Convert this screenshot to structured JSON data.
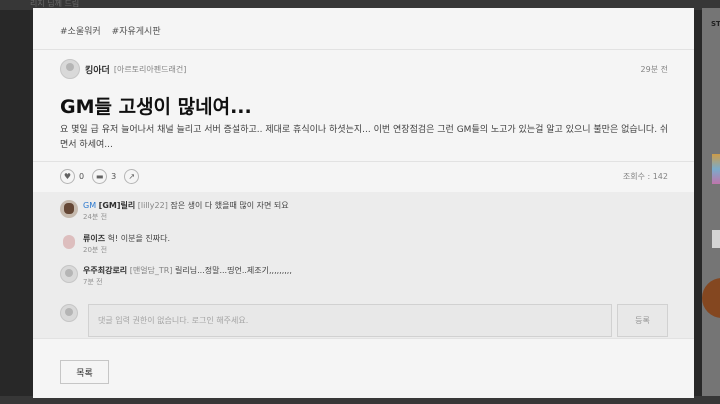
{
  "background": {
    "top_text": "리지 님께 드림",
    "right_label": "ST"
  },
  "post": {
    "tags": [
      "#소울워커",
      "#자유게시판"
    ],
    "author": {
      "name": "킹아더",
      "guild": "[아르토리아펜드래건]"
    },
    "time": "29분 전",
    "title": "GM들 고생이 많네여...",
    "body": "요 몇일 급 유저 늘어나서 채널 늘리고 서버 증설하고.. 제대로 휴식이나 하셧는지... 이번 연장점검은 그런 GM들의 노고가 있는걸 알고 있으니 불만은 없습니다. 쉬면서 하세여...",
    "likes": "0",
    "comments": "3",
    "views": "조회수 : 142"
  },
  "comments": [
    {
      "gm": "GM",
      "name": "[GM]릴리",
      "guild": "[lilly22]",
      "text": "잠은 생이 다 했을때 많이 자면 되요",
      "time": "24분 전"
    },
    {
      "gm": "",
      "name": "류이즈",
      "guild": "",
      "text": "헉! 이분을 진짜다.",
      "time": "20분 전"
    },
    {
      "gm": "",
      "name": "우주최강로리",
      "guild": "[맨얼담_TR]",
      "text": "릴리님...정말...띵언..제조기,,,,,,,,,",
      "time": "7분 전"
    }
  ],
  "comment_input": {
    "placeholder": "댓글 입력 권한이 없습니다. 로그인 해주세요.",
    "submit": "등록"
  },
  "footer": {
    "list_button": "목록"
  }
}
